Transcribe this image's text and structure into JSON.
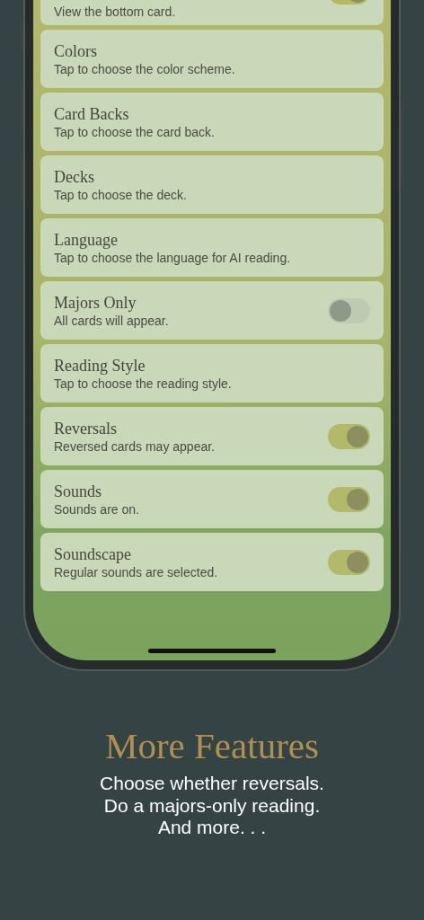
{
  "settings": [
    {
      "subtitle": "View the bottom card.",
      "kind": "toggle",
      "on": true
    },
    {
      "title": "Colors",
      "subtitle": "Tap to choose the color scheme.",
      "kind": "link"
    },
    {
      "title": "Card Backs",
      "subtitle": "Tap to choose the card back.",
      "kind": "link"
    },
    {
      "title": "Decks",
      "subtitle": "Tap to choose the deck.",
      "kind": "link"
    },
    {
      "title": "Language",
      "subtitle": "Tap to choose the language for AI reading.",
      "kind": "link"
    },
    {
      "title": "Majors Only",
      "subtitle": "All cards will appear.",
      "kind": "toggle",
      "on": false
    },
    {
      "title": "Reading Style",
      "subtitle": "Tap to choose the reading style.",
      "kind": "link"
    },
    {
      "title": "Reversals",
      "subtitle": "Reversed cards may appear.",
      "kind": "toggle",
      "on": true
    },
    {
      "title": "Sounds",
      "subtitle": "Sounds are on.",
      "kind": "toggle",
      "on": true
    },
    {
      "title": "Soundscape",
      "subtitle": "Regular sounds are selected.",
      "kind": "toggle",
      "on": true
    }
  ],
  "promo": {
    "headline": "More Features",
    "lines": [
      "Choose whether reversals.",
      "Do a majors-only reading.",
      "And more. . ."
    ]
  }
}
